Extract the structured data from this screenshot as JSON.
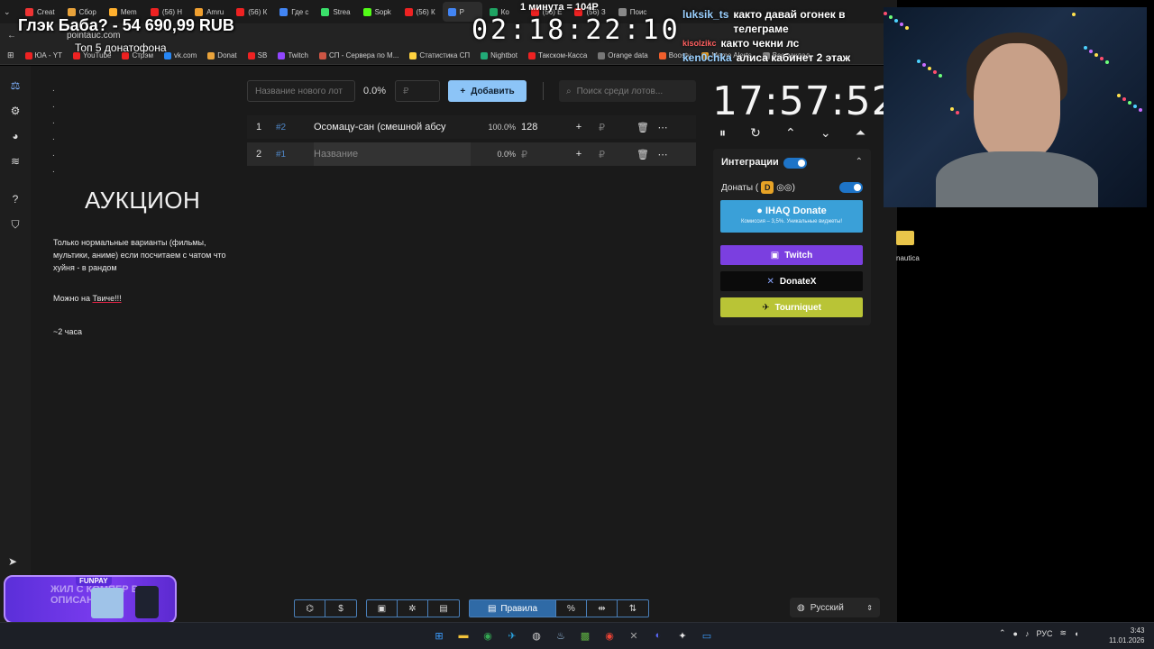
{
  "browser": {
    "tabs": [
      {
        "label": "Creat",
        "color": "#e33"
      },
      {
        "label": "Сбор",
        "color": "#e9a33b"
      },
      {
        "label": "Mem",
        "color": "#ffb02e"
      },
      {
        "label": "(56) Н",
        "color": "#e22"
      },
      {
        "label": "Amru",
        "color": "#f0a030"
      },
      {
        "label": "(56) К",
        "color": "#e22"
      },
      {
        "label": "Где с",
        "color": "#4285f4"
      },
      {
        "label": "Strea",
        "color": "#3ae06a"
      },
      {
        "label": "Sopk",
        "color": "#53fc18"
      },
      {
        "label": "(56) К",
        "color": "#e22"
      },
      {
        "label": "Р",
        "color": "#4285f4"
      },
      {
        "label": "Ко",
        "color": "#1fa463"
      },
      {
        "label": "(56) Е",
        "color": "#e22"
      },
      {
        "label": "(56) З",
        "color": "#e22"
      },
      {
        "label": "Поис",
        "color": "#888"
      }
    ],
    "url": "pointauc.com",
    "bookmarks": [
      {
        "label": "ЮА - YT",
        "color": "#e22"
      },
      {
        "label": "YouTube",
        "color": "#e22"
      },
      {
        "label": "Стрэм",
        "color": "#e22"
      },
      {
        "label": "vk.com",
        "color": "#2787f5"
      },
      {
        "label": "Donat",
        "color": "#e9a33b"
      },
      {
        "label": "SB",
        "color": "#e22"
      },
      {
        "label": "Twitch",
        "color": "#9146ff"
      },
      {
        "label": "СП - Сервера по М...",
        "color": "#c54"
      },
      {
        "label": "Статистика СП",
        "color": "#ffd23f"
      },
      {
        "label": "Nightbot",
        "color": "#2a7"
      },
      {
        "label": "Такском-Касса",
        "color": "#e22"
      },
      {
        "label": "Orange data",
        "color": "#777"
      },
      {
        "label": "Boosty",
        "color": "#f15f2c"
      },
      {
        "label": "Meme Alerts",
        "color": "#ffb02e"
      },
      {
        "label": "Все заклад",
        "color": "#888"
      }
    ]
  },
  "overlay": {
    "donation_line": "Глэк Баба? - 54 690,99 RUB",
    "top5": "Топ 5 донатофона",
    "big_clock": "02:18:22:10",
    "minute_label": "1 минута = 104Р"
  },
  "chat": [
    {
      "user": "luksik_ts",
      "text": "както давай огонек в телеграме",
      "red": false
    },
    {
      "user": "kisolzikc",
      "text": "както чекни лс",
      "red": true
    },
    {
      "user": "ken0chka",
      "text": "алиса кабинет 2 этаж",
      "red": false
    }
  ],
  "sidebar": {
    "icons": [
      {
        "name": "auction-icon",
        "glyph": "⚖",
        "active": true
      },
      {
        "name": "settings-icon",
        "glyph": "⚙",
        "active": false
      },
      {
        "name": "wheel-icon",
        "glyph": "◕",
        "active": false
      },
      {
        "name": "layers-icon",
        "glyph": "≋",
        "active": false
      },
      {
        "name": "help-icon",
        "glyph": "?",
        "active": false
      },
      {
        "name": "shield-icon",
        "glyph": "⛉",
        "active": false
      }
    ],
    "telegram_glyph": "➤"
  },
  "left_panel": {
    "dots": [
      ".",
      ".",
      ".",
      ".",
      ".",
      "."
    ],
    "title": "АУКЦИОН",
    "description": "Только нормальные варианты (фильмы, мультики, аниме) если посчитаем с чатом что хуйня - в рандом",
    "line2_prefix": "Можно на",
    "line2_link": "Твиче!!!",
    "line3": "~2 часа"
  },
  "lot_controls": {
    "new_lot_placeholder": "Название нового лот",
    "pct": "0.0%",
    "amount_placeholder": "₽",
    "add_button": "Добавить",
    "search_placeholder": "Поиск среди лотов..."
  },
  "lots": [
    {
      "num": "1",
      "fast_id": "#2",
      "name": "Осомацу-сан (смешной абсу",
      "pct": "100.0%",
      "amount": "128",
      "rub": "₽"
    },
    {
      "num": "2",
      "fast_id": "#1",
      "name": "Название",
      "pct": "0.0%",
      "amount": "₽",
      "rub": "₽"
    }
  ],
  "timer": {
    "value": "17:57:52",
    "controls": [
      "⏸",
      "↻",
      "⌃",
      "⌄",
      "⏶"
    ]
  },
  "integrations": {
    "title": "Интеграции",
    "donats_label": "Донаты (",
    "donats_suffix": "◎◎)",
    "ihaq_title": "IHAQ Donate",
    "ihaq_sub": "Комиссия – 3,5%. Уникальные виджеты!",
    "twitch": "Twitch",
    "donatex": "DonateX",
    "tourniquet": "Tourniquet"
  },
  "bottom": {
    "group1": [
      "⌬",
      "$"
    ],
    "group2": [
      "▣",
      "✲",
      "▤"
    ],
    "rules_label": "Правила",
    "group3_rest": [
      "%",
      "⇹",
      "⇅"
    ],
    "language": "Русский"
  },
  "desktop": {
    "file_label": "nautica"
  },
  "funpay": {
    "tag": "FUNPAY",
    "text": "ЖИЛ С КОМПЕР В ОПИСАНИИ"
  },
  "taskbar": {
    "icons": [
      {
        "name": "windows-start-icon",
        "glyph": "⊞",
        "color": "#3b9cff"
      },
      {
        "name": "explorer-icon",
        "glyph": "▬",
        "color": "#f3c33a"
      },
      {
        "name": "chrome-icon",
        "glyph": "◉",
        "color": "#34a853"
      },
      {
        "name": "telegram-icon",
        "glyph": "✈",
        "color": "#2aa1de"
      },
      {
        "name": "obs-icon",
        "glyph": "◍",
        "color": "#cfcfcf"
      },
      {
        "name": "steam-icon",
        "glyph": "♨",
        "color": "#9cc3e6"
      },
      {
        "name": "minecraft-icon",
        "glyph": "▩",
        "color": "#5eb042"
      },
      {
        "name": "chrome2-icon",
        "glyph": "◉",
        "color": "#ea4335"
      },
      {
        "name": "xbox-icon",
        "glyph": "✕",
        "color": "#a0a0a0"
      },
      {
        "name": "discord-icon",
        "glyph": "◐",
        "color": "#5865f2"
      },
      {
        "name": "app-icon",
        "glyph": "✦",
        "color": "#e5e5e5"
      },
      {
        "name": "monitor-icon",
        "glyph": "▭",
        "color": "#3b9cff"
      }
    ],
    "lang": "РУС",
    "time": "3:43",
    "date": "11.01.2026"
  }
}
